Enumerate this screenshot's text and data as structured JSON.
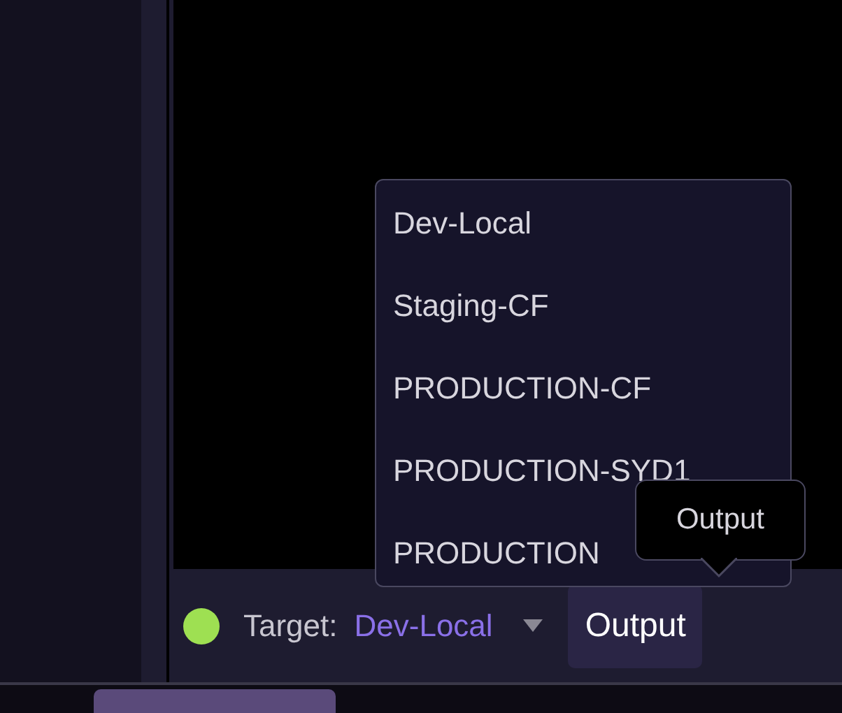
{
  "dropdown": {
    "items": [
      {
        "label": "Dev-Local"
      },
      {
        "label": "Staging-CF"
      },
      {
        "label": "PRODUCTION-CF"
      },
      {
        "label": "PRODUCTION-SYD1"
      },
      {
        "label": "PRODUCTION"
      }
    ]
  },
  "tooltip": {
    "text": "Output"
  },
  "status_bar": {
    "target_label": "Target:",
    "target_value": "Dev-Local",
    "output_button": "Output"
  }
}
